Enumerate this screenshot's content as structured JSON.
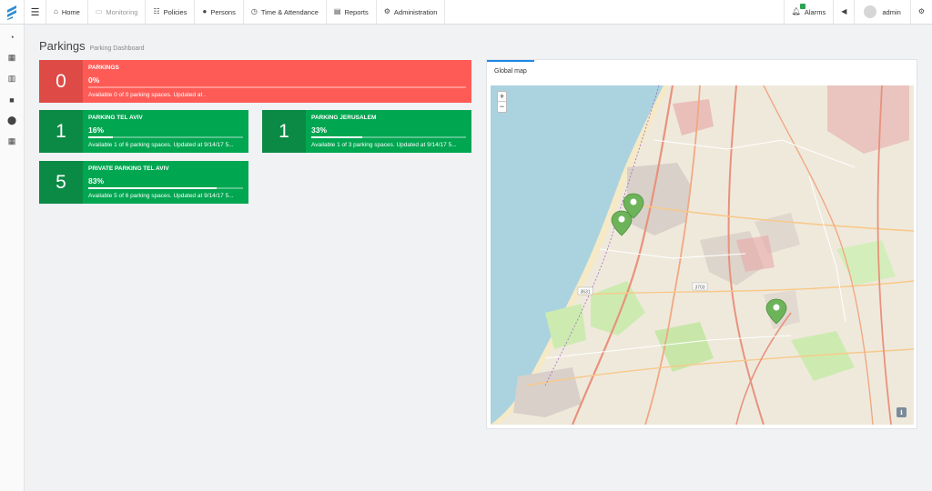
{
  "nav": {
    "items": [
      {
        "label": "Home",
        "icon": "home-icon"
      },
      {
        "label": "Monitoring",
        "icon": "monitor-icon"
      },
      {
        "label": "Policies",
        "icon": "sliders-icon"
      },
      {
        "label": "Persons",
        "icon": "user-icon"
      },
      {
        "label": "Time & Attendance",
        "icon": "clock-icon"
      },
      {
        "label": "Reports",
        "icon": "report-icon"
      },
      {
        "label": "Administration",
        "icon": "gear-icon"
      }
    ],
    "alarms_label": "Alarms",
    "user_label": "admin"
  },
  "sidebar": {
    "items": [
      "dashboard-icon",
      "floorplan-icon",
      "map-icon",
      "camera-icon",
      "location-icon",
      "grid-icon"
    ]
  },
  "page": {
    "title": "Parkings",
    "subtitle": "Parking Dashboard"
  },
  "tiles": [
    {
      "count": "0",
      "title": "PARKINGS",
      "percent": "0%",
      "fill": 0,
      "description": "Available 0 of 0 parking spaces. Updated at .",
      "color": "#ff5b56"
    },
    {
      "count": "1",
      "title": "PARKING TEL AVIV",
      "percent": "16%",
      "fill": 0.16,
      "description": "Available 1 of 6 parking spaces. Updated at 9/14/17 5...",
      "color": "#00a650"
    },
    {
      "count": "1",
      "title": "PARKING JERUSALEM",
      "percent": "33%",
      "fill": 0.33,
      "description": "Available 1 of 3 parking spaces. Updated at 9/14/17 5...",
      "color": "#00a650"
    },
    {
      "count": "5",
      "title": "PRIVATE PARKING TEL AVIV",
      "percent": "83%",
      "fill": 0.83,
      "description": "Available 5 of 6 parking spaces. Updated at 9/14/17 5...",
      "color": "#00a650"
    }
  ],
  "map": {
    "tab_label": "Global map",
    "zoom_in": "+",
    "zoom_out": "−",
    "info": "i",
    "road_labels": [
      "3631",
      "3703"
    ]
  }
}
